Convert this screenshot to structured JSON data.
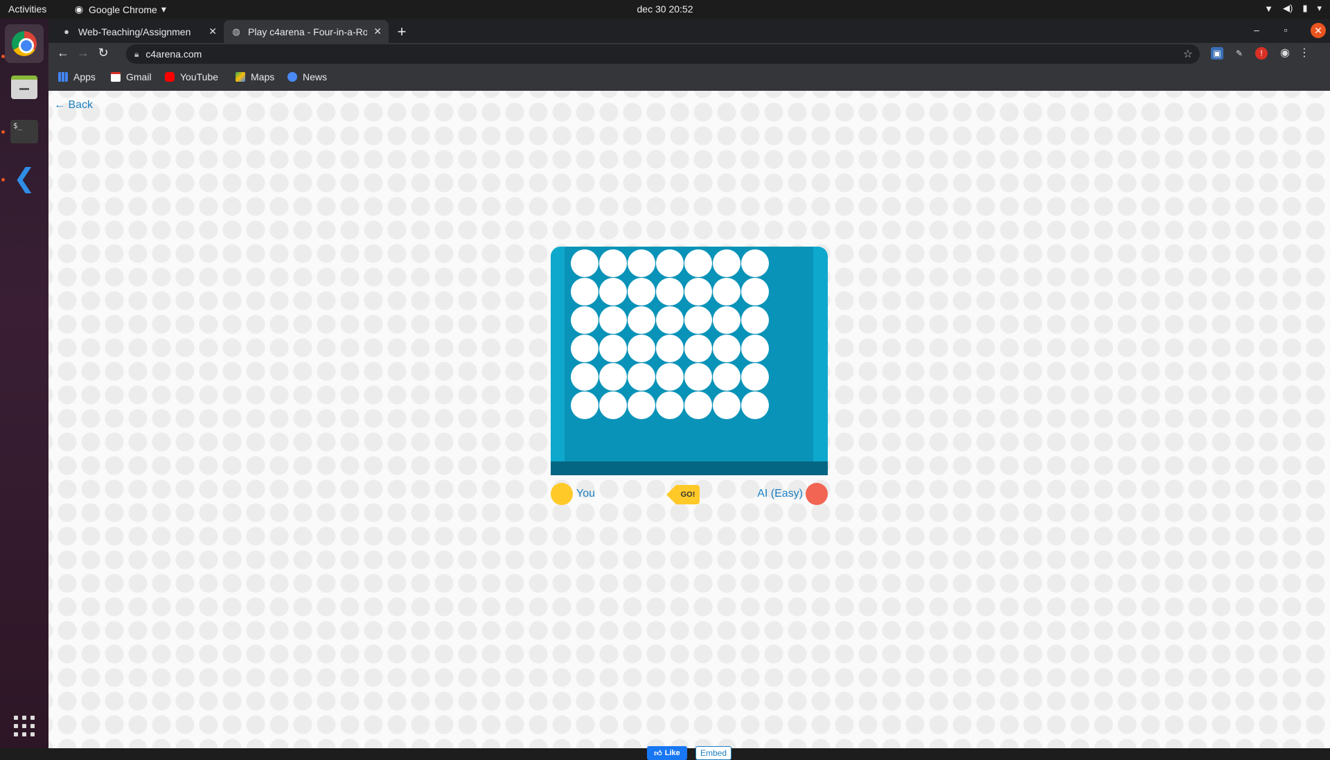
{
  "topbar": {
    "activities": "Activities",
    "app_name": "Google Chrome",
    "clock": "dec 30  20:52"
  },
  "dock": {
    "items": [
      "chrome-icon",
      "files-icon",
      "terminal-icon",
      "vscode-icon",
      "show-apps-icon"
    ]
  },
  "browser": {
    "tabs": [
      {
        "title": "Web-Teaching/Assignmen",
        "favicon": "github-icon",
        "active": false
      },
      {
        "title": "Play c4arena - Four-in-a-Ro",
        "favicon": "globe-icon",
        "active": true
      }
    ],
    "url": "c4arena.com",
    "bookmarks": [
      {
        "label": "Apps",
        "icon": "apps-grid-icon"
      },
      {
        "label": "Gmail",
        "icon": "gmail-icon"
      },
      {
        "label": "YouTube",
        "icon": "youtube-icon"
      },
      {
        "label": "Maps",
        "icon": "maps-icon"
      },
      {
        "label": "News",
        "icon": "news-icon"
      }
    ]
  },
  "page": {
    "back_label": "Back",
    "board": {
      "rows": 6,
      "columns": 7,
      "board_color": "#0ea8cc",
      "frame_color": "#0a93b8"
    },
    "player_you": {
      "name": "You",
      "color": "#ffc928"
    },
    "player_ai": {
      "name": "AI (Easy)",
      "color": "#f26552"
    },
    "turn_badge": "GO!",
    "like_label": "Like",
    "embed_label": "Embed"
  }
}
